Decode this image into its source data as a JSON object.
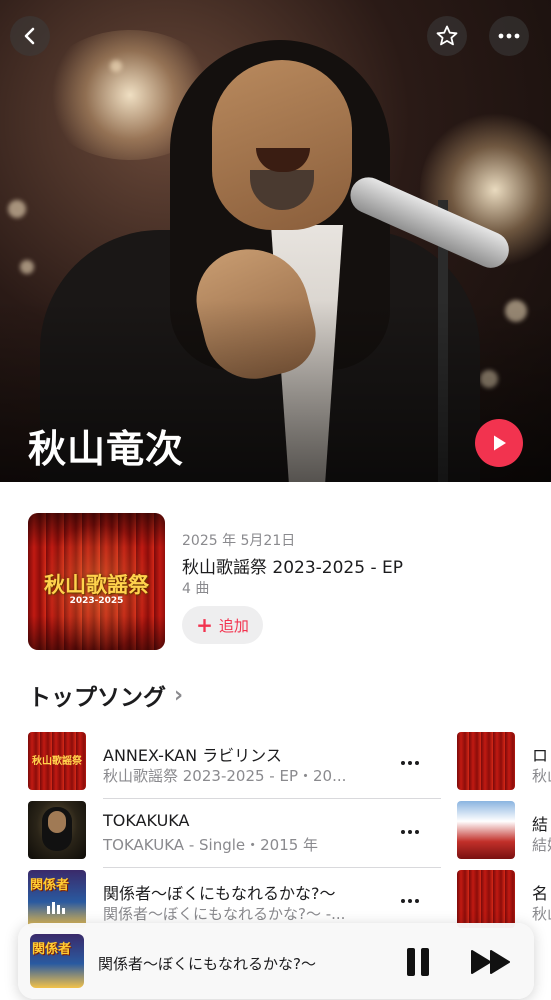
{
  "hero": {
    "artist_name": "秋山竜次"
  },
  "latest_release": {
    "date": "2025 年 5月21日",
    "title": "秋山歌謡祭 2023-2025 - EP",
    "track_count": "4 曲",
    "add_label": "追加",
    "cover_title": "秋山歌謡祭",
    "cover_subtitle": "2023-2025"
  },
  "top_songs": {
    "section_title": "トップソング",
    "songs": [
      {
        "title": "ANNEX-KAN ラビリンス",
        "subtitle": "秋山歌謡祭 2023-2025 - EP・20...",
        "thumb_text": "秋山歌謡祭"
      },
      {
        "title": "TOKAKUKA",
        "subtitle": "TOKAKUKA - Single・2015 年"
      },
      {
        "title": "関係者〜ぼくにもなれるかな?〜",
        "subtitle": "関係者〜ぼくにもなれるかな?〜 -...",
        "thumb_text": "関係者"
      }
    ],
    "peek": [
      {
        "title": "ロ",
        "subtitle": "秋山"
      },
      {
        "title": "結",
        "subtitle": "結婚"
      },
      {
        "title": "名",
        "subtitle": "秋山"
      }
    ]
  },
  "now_playing": {
    "title": "関係者〜ぼくにもなれるかな?〜",
    "art_text": "関係者"
  },
  "colors": {
    "accent": "#f2334f",
    "secondary_text": "#8a8a8e"
  },
  "icons": {
    "back": "chevron-left-icon",
    "favorite": "star-icon",
    "more": "ellipsis-icon",
    "play": "play-icon",
    "add": "plus-icon",
    "pause": "pause-icon",
    "forward": "fast-forward-icon"
  }
}
